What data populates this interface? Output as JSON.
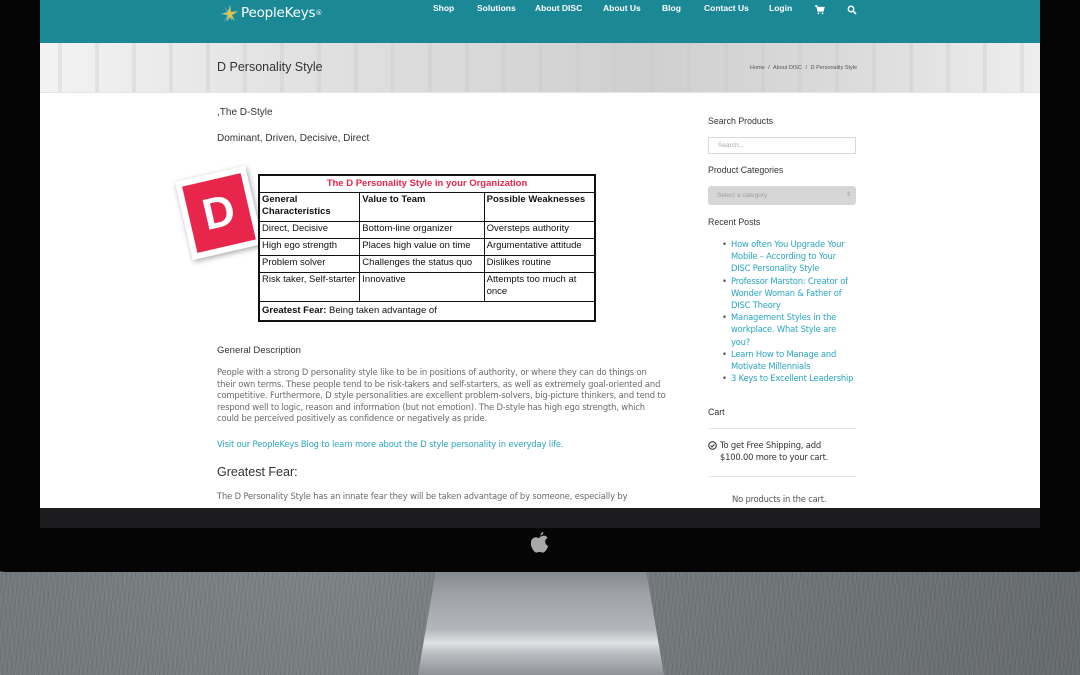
{
  "site": {
    "logo_text": "PeopleKeys",
    "logo_mark": "registered-mark",
    "brand_color": "#1b8896",
    "accent_red": "#e8264c",
    "link_color": "#2aa4bf"
  },
  "nav": {
    "items": [
      {
        "label": "Shop"
      },
      {
        "label": "Solutions"
      },
      {
        "label": "About DISC"
      },
      {
        "label": "About Us"
      },
      {
        "label": "Blog"
      },
      {
        "label": "Contact Us"
      },
      {
        "label": "Login"
      }
    ],
    "icons": [
      "cart-icon",
      "search-icon"
    ]
  },
  "titlebar": {
    "title": "D Personality Style",
    "breadcrumb": [
      "Home",
      "About DISC",
      "D Personality Style"
    ],
    "separator": "/"
  },
  "content": {
    "heading": ",The D-Style",
    "subtitle": "Dominant, Driven, Decisive, Direct",
    "badge_letter": "D",
    "table": {
      "caption": "The D Personality Style in your Organization",
      "headers": [
        "General Characteristics",
        "Value to Team",
        "Possible Weaknesses"
      ],
      "rows": [
        [
          "Direct, Decisive",
          "Bottom-line organizer",
          "Oversteps authority"
        ],
        [
          "High ego strength",
          "Places high value on time",
          "Argumentative attitude"
        ],
        [
          "Problem solver",
          "Challenges the status quo",
          "Dislikes routine"
        ],
        [
          "Risk taker, Self-starter",
          "Innovative",
          "Attempts too much at once"
        ]
      ],
      "footer_label": "Greatest Fear:",
      "footer_value": " Being taken advantage of"
    },
    "general_heading": "General Description",
    "general_text": "People with a strong D personality style like to be in positions of authority, or where they can do things on their own terms. These people tend to be risk-takers and self-starters, as well as extremely goal-oriented and competitive. Furthermore, D style personalities are excellent problem-solvers,  big-picture thinkers, and tend to respond well to logic, reason and information (but not emotion).  The D-style has high ego strength, which could be perceived positively as confidence or negatively as pride.",
    "blog_link": "Visit our PeopleKeys Blog to learn more about the D style personality in everyday life.",
    "fear_heading": "Greatest Fear:",
    "fear_text": "The D Personality Style has an innate fear they will be taken advantage of by someone, especially by"
  },
  "sidebar": {
    "search_heading": "Search Products",
    "search_placeholder": "Search...",
    "categories_heading": "Product Categories",
    "category_select": "Select a category",
    "recent_heading": "Recent Posts",
    "recent_posts": [
      "How often You Upgrade Your Mobile – According to Your DISC Personality Style",
      "Professor Marston: Creator of Wonder Woman & Father of DISC Theory",
      "Management Styles in the workplace. What Style are you?",
      "Learn How to Manage and Motivate Millennials",
      "3 Keys to Excellent Leadership"
    ],
    "cart_heading": "Cart",
    "shipping_notice": "To get Free Shipping, add $100.00 more to your cart.",
    "empty_cart": "No products in the cart."
  }
}
